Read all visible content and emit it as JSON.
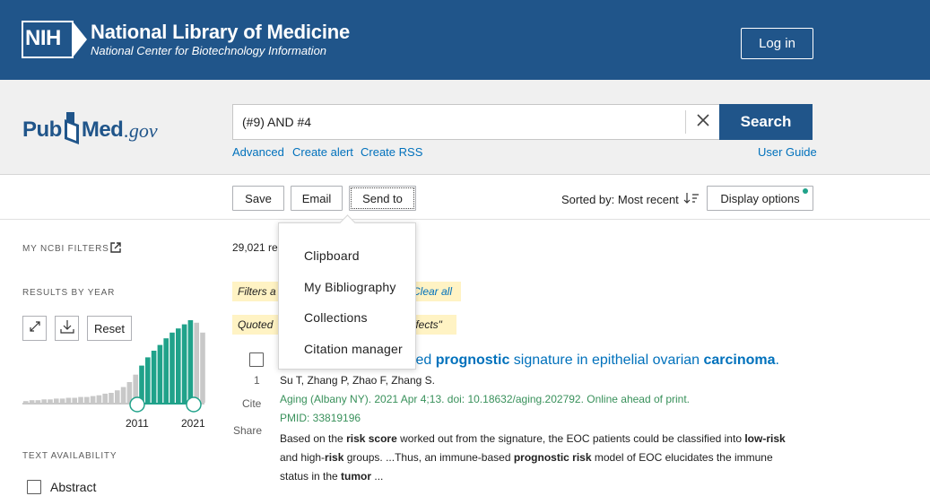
{
  "nih": {
    "logo_text": "NIH",
    "title": "National Library of Medicine",
    "subtitle": "National Center for Biotechnology Information",
    "login_label": "Log in"
  },
  "pubmed": {
    "logo_pub": "Pub",
    "logo_med": "Med",
    "logo_gov": ".gov"
  },
  "search": {
    "query": "(#9) AND #4",
    "button_label": "Search",
    "links": {
      "advanced": "Advanced",
      "create_alert": "Create alert",
      "create_rss": "Create RSS",
      "user_guide": "User Guide"
    }
  },
  "toolbar": {
    "save_label": "Save",
    "email_label": "Email",
    "send_label": "Send to",
    "sorted_label": "Sorted by: Most recent",
    "display_label": "Display options"
  },
  "send_menu": {
    "items": [
      "Clipboard",
      "My Bibliography",
      "Collections",
      "Citation manager"
    ]
  },
  "sidebar": {
    "filters_label": "MY NCBI FILTERS",
    "results_by_year_label": "RESULTS BY YEAR",
    "reset_label": "Reset",
    "year_start": "2011",
    "year_end": "2021",
    "text_availability_label": "TEXT AVAILABILITY",
    "abstract_label": "Abstract",
    "histogram_values": [
      2,
      3,
      3,
      4,
      4,
      5,
      5,
      6,
      6,
      7,
      7,
      8,
      9,
      11,
      12,
      15,
      19,
      25,
      34,
      45,
      55,
      63,
      70,
      78,
      85,
      90,
      95,
      100,
      97,
      85
    ]
  },
  "results": {
    "count": "29,021 re",
    "pill_a_text": "Filters a",
    "pill_a_link": "Clear all",
    "pill_b_text": "Quoted",
    "pill_b_tail": "ffects\"",
    "item": {
      "number": "1",
      "cite_label": "Cite",
      "share_label": "Share",
      "title_part1": "ted ",
      "title_bold1": "prognostic",
      "title_part2": " signature in epithelial ovarian ",
      "title_bold2": "carcinoma",
      "title_part3": ".",
      "authors": "Su T, Zhang P, Zhao F, Zhang S.",
      "journal": "Aging (Albany NY). 2021 Apr 4;13. doi: 10.18632/aging.202792. Online ahead of print.",
      "pmid": "PMID: 33819196",
      "snippet_1a": "Based on the ",
      "snippet_1b": "risk score",
      "snippet_1c": " worked out from the signature, the EOC patients could be classified into ",
      "snippet_1d": "low-risk",
      "snippet_1e": " and high-",
      "snippet_1f": "risk",
      "snippet_1g": " groups. ...Thus, an immune-based ",
      "snippet_1h": "prognostic risk",
      "snippet_1i": " model of EOC elucidates the immune status in the ",
      "snippet_1j": "tumor",
      "snippet_1k": " ..."
    }
  },
  "colors": {
    "nih_blue": "#20558a",
    "link_blue": "#0071bc",
    "citation_green": "#39915b",
    "histogram_teal": "#20a28a",
    "pill_yellow": "#fff3c4"
  }
}
